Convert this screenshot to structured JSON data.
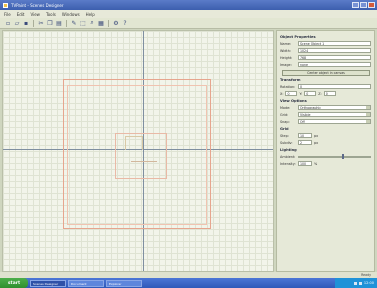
{
  "app": {
    "title": "TVPaint - Scenes Designer",
    "accent": "#3c5fae"
  },
  "menubar": {
    "items": [
      "File",
      "Edit",
      "View",
      "Tools",
      "Windows",
      "Help"
    ]
  },
  "toolbar": {
    "icons": [
      "new-icon",
      "open-icon",
      "save-icon",
      "cut-icon",
      "copy-icon",
      "paste-icon",
      "pencil-icon",
      "select-icon",
      "zoom-icon",
      "grid-icon",
      "settings-icon",
      "help-icon"
    ]
  },
  "panel": {
    "object_title": "Object Properties",
    "name_label": "Name:",
    "name_value": "Scene Object 1",
    "width_label": "Width:",
    "width_value": "1024",
    "height_label": "Height:",
    "height_value": "768",
    "image_label": "Image:",
    "image_value": "none",
    "center_button": "Center object in canvas",
    "transform_title": "Transform",
    "rotation_label": "Rotation:",
    "rotation_value": "0",
    "pos_x_label": "X:",
    "pos_x_value": "0",
    "pos_y_label": "Y:",
    "pos_y_value": "0",
    "pos_z_label": "Z:",
    "pos_z_value": "0",
    "view_title": "View Options",
    "mode_label": "Mode:",
    "mode_value": "Orthographic",
    "grid_label": "Grid:",
    "grid_value": "Visible",
    "snap_label": "Snap:",
    "snap_value": "Off",
    "size_title": "Grid",
    "step_label": "Step:",
    "step_value": "10",
    "step_unit": "px",
    "subdiv_label": "Subdiv:",
    "subdiv_value": "2",
    "subdiv_unit": "px",
    "light_title": "Lighting",
    "ambient_label": "Ambient:",
    "ambient_level": 0.6,
    "intensity_label": "Intensity:",
    "intensity_value": "100",
    "intensity_unit": "%"
  },
  "statusbar": {
    "text": "Ready"
  },
  "taskbar": {
    "start_label": "start",
    "tasks": [
      "Scenes Designer",
      "Document",
      "Explorer"
    ],
    "clock": "12:00"
  }
}
